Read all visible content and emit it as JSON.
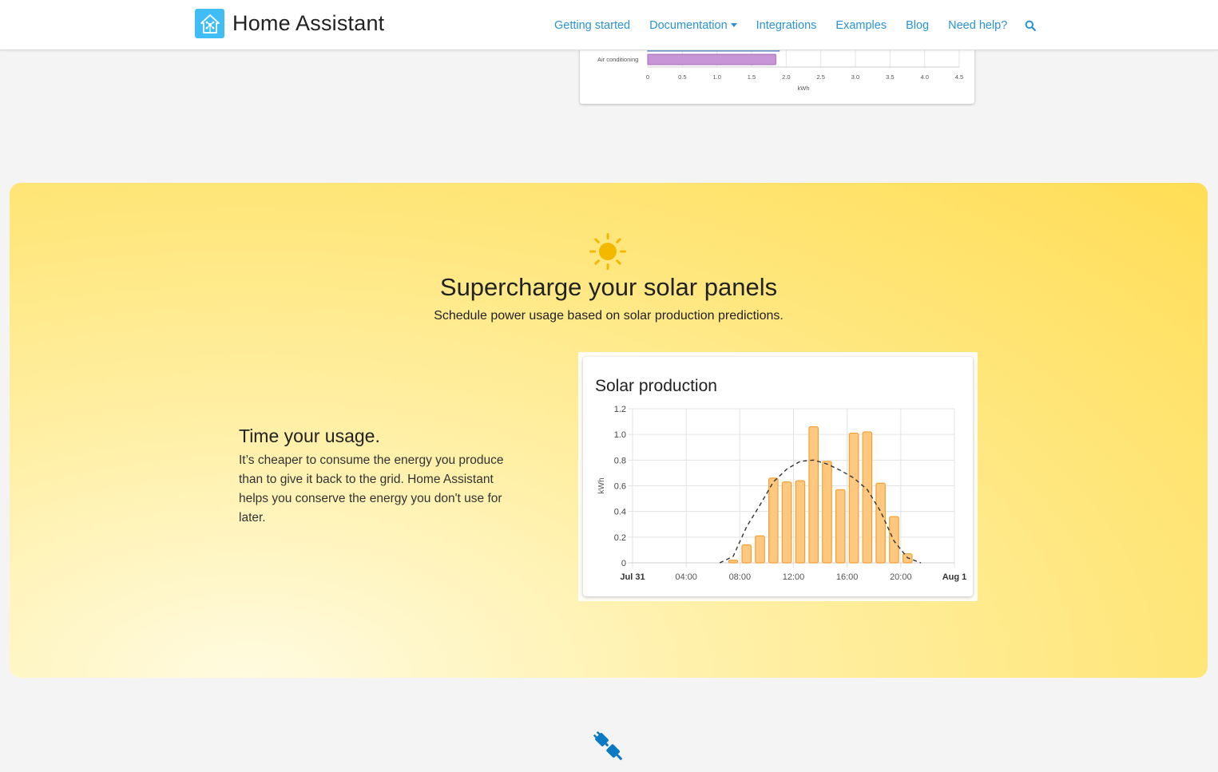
{
  "header": {
    "brand_name": "Home Assistant",
    "brand_icon": "home-assistant-logo-icon",
    "nav": [
      {
        "label": "Getting started"
      },
      {
        "label": "Documentation",
        "has_dropdown": true
      },
      {
        "label": "Integrations"
      },
      {
        "label": "Examples"
      },
      {
        "label": "Blog"
      },
      {
        "label": "Need help?"
      }
    ],
    "search_icon": "search-icon",
    "link_color": "#2a93d1"
  },
  "previous_section": {
    "chart": {
      "category_label": "Air conditioning",
      "x_ticks": [
        "0",
        "0.5",
        "1.0",
        "1.5",
        "2.0",
        "2.5",
        "3.0",
        "3.5",
        "4.0",
        "4.5"
      ],
      "x_unit": "kWh",
      "bar_value": 1.85,
      "bar_color": "#c895d6"
    }
  },
  "solar_section": {
    "icon": "sun-icon",
    "title": "Supercharge your solar panels",
    "subtitle": "Schedule power usage based on solar production predictions.",
    "feature_title": "Time your usage.",
    "feature_text": "It’s cheaper to consume the energy you produce than to give it back to the grid. Home Assistant helps you conserve the energy you don't use for later.",
    "accent_color": "#f5b800"
  },
  "chart_data": {
    "type": "bar",
    "title": "Solar production",
    "ylabel": "kWh",
    "ylim": [
      0,
      1.2
    ],
    "y_ticks": [
      "0",
      "0.2",
      "0.4",
      "0.6",
      "0.8",
      "1.0",
      "1.2"
    ],
    "x_ticks": [
      "Jul 31",
      "04:00",
      "08:00",
      "12:00",
      "16:00",
      "20:00",
      "Aug 1"
    ],
    "bar_color": "#ffc880",
    "bar_border_color": "#f5a030",
    "bars": [
      {
        "hour": 7,
        "value": 0.02
      },
      {
        "hour": 8,
        "value": 0.14
      },
      {
        "hour": 9,
        "value": 0.21
      },
      {
        "hour": 10,
        "value": 0.66
      },
      {
        "hour": 11,
        "value": 0.63
      },
      {
        "hour": 12,
        "value": 0.64
      },
      {
        "hour": 13,
        "value": 1.06
      },
      {
        "hour": 14,
        "value": 0.79
      },
      {
        "hour": 15,
        "value": 0.57
      },
      {
        "hour": 16,
        "value": 1.01
      },
      {
        "hour": 17,
        "value": 1.02
      },
      {
        "hour": 18,
        "value": 0.62
      },
      {
        "hour": 19,
        "value": 0.36
      },
      {
        "hour": 20,
        "value": 0.07
      }
    ],
    "forecast": [
      {
        "hour": 6.5,
        "value": 0.0
      },
      {
        "hour": 7.5,
        "value": 0.05
      },
      {
        "hour": 8.5,
        "value": 0.28
      },
      {
        "hour": 9.5,
        "value": 0.45
      },
      {
        "hour": 10.5,
        "value": 0.63
      },
      {
        "hour": 11.5,
        "value": 0.73
      },
      {
        "hour": 12.5,
        "value": 0.79
      },
      {
        "hour": 13.5,
        "value": 0.8
      },
      {
        "hour": 14.5,
        "value": 0.77
      },
      {
        "hour": 15.5,
        "value": 0.72
      },
      {
        "hour": 16.5,
        "value": 0.66
      },
      {
        "hour": 17.5,
        "value": 0.57
      },
      {
        "hour": 18.5,
        "value": 0.4
      },
      {
        "hour": 19.5,
        "value": 0.17
      },
      {
        "hour": 20.5,
        "value": 0.04
      },
      {
        "hour": 21.5,
        "value": 0.0
      }
    ]
  },
  "next_section": {
    "icon": "plug-icon",
    "icon_color": "#0a7ac4"
  }
}
